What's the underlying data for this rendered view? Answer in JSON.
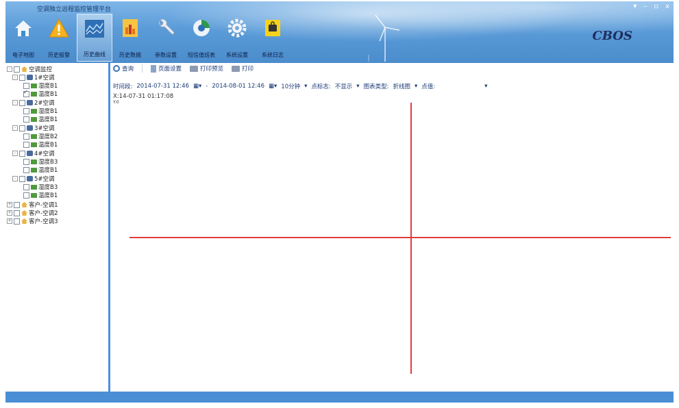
{
  "window": {
    "title": "空调独立远程监控管理平台",
    "controls": [
      "▾",
      "–",
      "▫",
      "x"
    ],
    "brand": "CBOS"
  },
  "toolbar": [
    {
      "label": "电子地图",
      "icon": "home-icon"
    },
    {
      "label": "历史报警",
      "icon": "warning-icon"
    },
    {
      "label": "历史曲线",
      "icon": "curve-icon",
      "active": true
    },
    {
      "label": "历史数据",
      "icon": "data-icon"
    },
    {
      "label": "参数设置",
      "icon": "wrench-icon"
    },
    {
      "label": "短信值班表",
      "icon": "sms-icon"
    },
    {
      "label": "系统设置",
      "icon": "gear-icon"
    },
    {
      "label": "系统日志",
      "icon": "log-icon"
    }
  ],
  "tree": {
    "root": "空调监控",
    "groups": [
      {
        "name": "1#空调",
        "items": [
          {
            "label": "湿度B1",
            "checked": false
          },
          {
            "label": "温度B1",
            "checked": true
          }
        ]
      },
      {
        "name": "2#空调",
        "items": [
          {
            "label": "湿度B1",
            "checked": false
          },
          {
            "label": "温度B1",
            "checked": false
          }
        ]
      },
      {
        "name": "3#空调",
        "items": [
          {
            "label": "湿度B2",
            "checked": false
          },
          {
            "label": "温度B1",
            "checked": false
          }
        ]
      },
      {
        "name": "4#空调",
        "items": [
          {
            "label": "湿度B3",
            "checked": false
          },
          {
            "label": "温度B1",
            "checked": false
          }
        ]
      },
      {
        "name": "5#空调",
        "items": [
          {
            "label": "湿度B3",
            "checked": false
          },
          {
            "label": "温度B1",
            "checked": false
          }
        ]
      }
    ],
    "customers": [
      "客户-空调1",
      "客户-空调2",
      "客户-空调3"
    ]
  },
  "subbar": {
    "query": "查询",
    "page_setup": "页面设置",
    "print_preview": "打印预览",
    "print": "打印"
  },
  "filters": {
    "period_label": "时间段:",
    "start": "2014-07-31 12:46",
    "dash": "-",
    "end": "2014-08-01 12:46",
    "interval": "10分钟",
    "marker_label": "点标志:",
    "marker_value": "不显示",
    "chart_type_label": "图表类型:",
    "chart_type_value": "折线图",
    "line_label": "点值:"
  },
  "coord_readout": "X:14-07-31 01:17:08",
  "y_unit": "Y:0",
  "colors": {
    "ribbon": "#5a9bd8",
    "accent": "#4a90d9",
    "crosshair": "#e23b3b"
  }
}
